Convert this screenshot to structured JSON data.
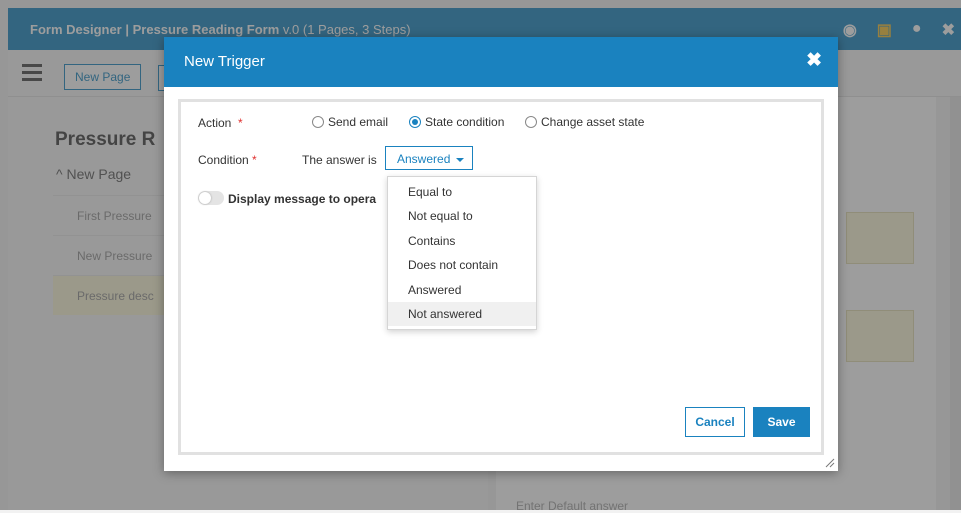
{
  "app": {
    "title": "Form Designer | Pressure Reading Form",
    "title_detail": " v.0 (1 Pages, 3 Steps)"
  },
  "toolbar": {
    "new_page_label": "New Page"
  },
  "sidebar": {
    "title": "Pressure R",
    "group_label": "New Page",
    "items": [
      {
        "label": "First Pressure"
      },
      {
        "label": "New Pressure"
      },
      {
        "label": "Pressure desc"
      }
    ]
  },
  "main": {
    "bottom_label": "Enter Default answer"
  },
  "modal": {
    "title": "New Trigger",
    "action_label": "Action",
    "required_mark": "*",
    "action_options": [
      {
        "label": "Send email",
        "checked": false
      },
      {
        "label": "State condition",
        "checked": true
      },
      {
        "label": "Change asset state",
        "checked": false
      }
    ],
    "condition_label": "Condition",
    "condition_prefix": "The answer is",
    "condition_value": "Answered",
    "toggle_label": "Display message to opera",
    "dropdown_options": [
      "Equal to",
      "Not equal to",
      "Contains",
      "Does not contain",
      "Answered",
      "Not answered"
    ],
    "dropdown_hovered": "Not answered",
    "cancel_label": "Cancel",
    "save_label": "Save"
  },
  "colors": {
    "accent": "#1a82bf",
    "required": "#e0302e",
    "highlight": "#fbf6d9"
  }
}
